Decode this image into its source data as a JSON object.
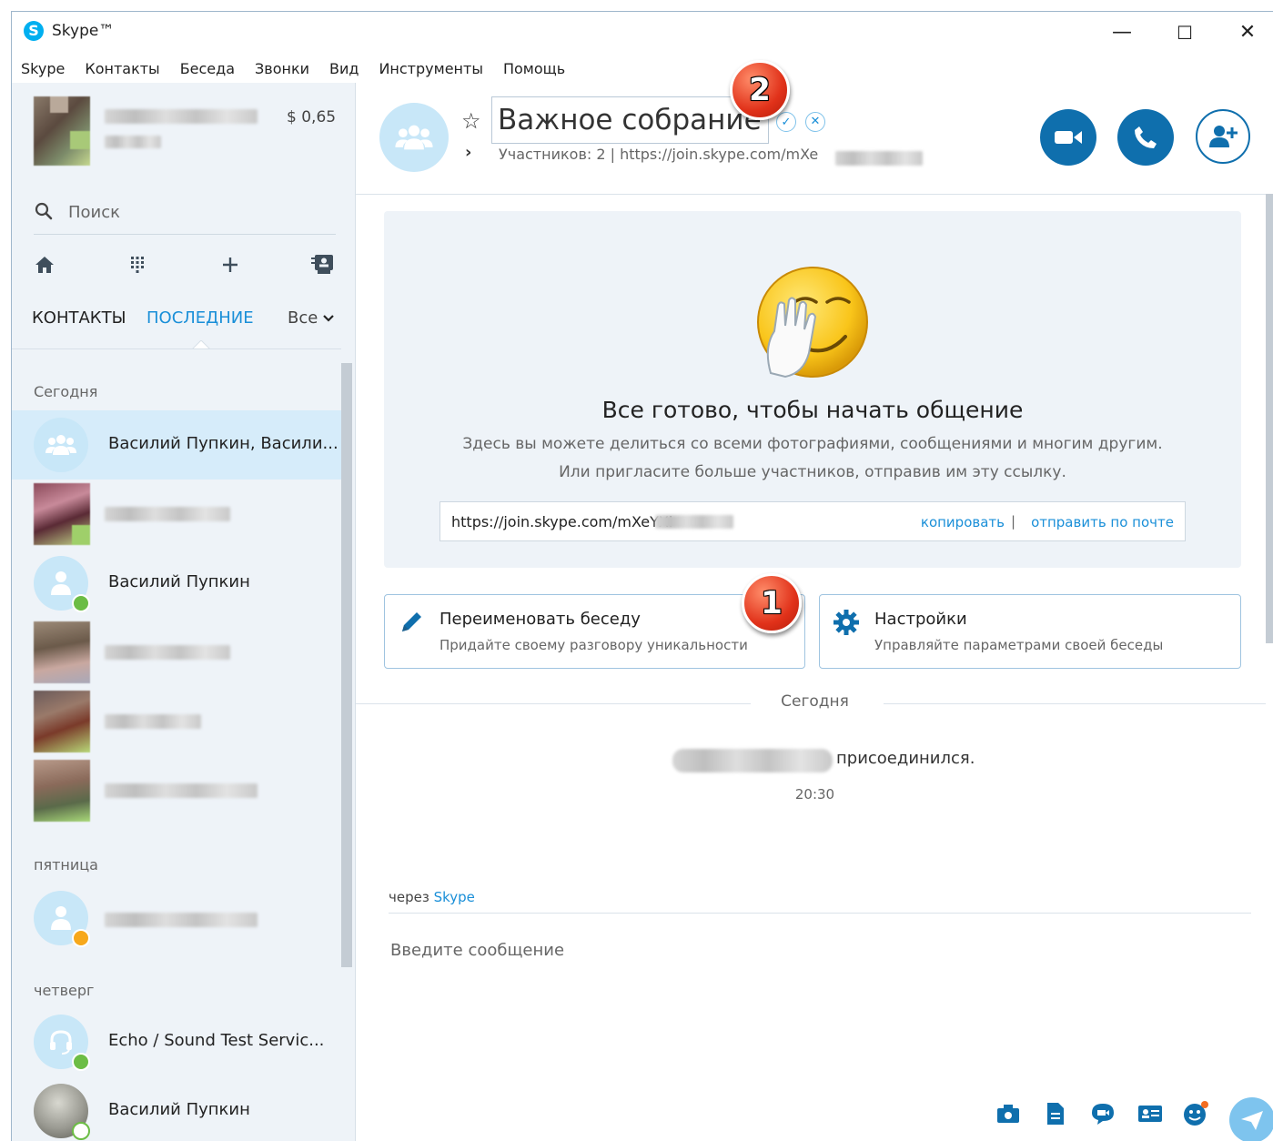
{
  "titlebar": {
    "app_name": "Skype™",
    "minimize": "—",
    "maximize": "☐",
    "close": "✕"
  },
  "menu": [
    "Skype",
    "Контакты",
    "Беседа",
    "Звонки",
    "Вид",
    "Инструменты",
    "Помощь"
  ],
  "profile": {
    "balance": "$ 0,65"
  },
  "search": {
    "placeholder": "Поиск"
  },
  "nav_icons": [
    "home-icon",
    "dialpad-icon",
    "plus-icon",
    "contacts-card-icon"
  ],
  "tabs": {
    "contacts": "КОНТАКТЫ",
    "recent": "ПОСЛЕДНИЕ",
    "filter": "Все"
  },
  "list": {
    "sections": {
      "today": "Сегодня",
      "friday": "пятница",
      "thursday": "четверг"
    },
    "items": [
      {
        "name": "Василий Пупкин, Васили...",
        "type": "group",
        "selected": true
      },
      {
        "name": "",
        "type": "blurred"
      },
      {
        "name": "Василий Пупкин",
        "type": "person",
        "status": "online"
      },
      {
        "name": "",
        "type": "blurred"
      },
      {
        "name": "",
        "type": "blurred"
      },
      {
        "name": "",
        "type": "blurred"
      },
      {
        "name": "",
        "type": "person",
        "status": "away"
      },
      {
        "name": "Echo / Sound Test Servic...",
        "type": "echo",
        "status": "online"
      },
      {
        "name": "Василий Пупкин",
        "type": "photo",
        "status": "online"
      }
    ]
  },
  "conversation": {
    "title": "Важное собрание",
    "subtitle": "Участников: 2 | https://join.skype.com/mXe",
    "welcome_title": "Все готово, чтобы начать общение",
    "welcome_line1": "Здесь вы можете делиться со всеми фотографиями, сообщениями и многим другим.",
    "welcome_line2": "Или пригласите больше участников, отправив им эту ссылку.",
    "link": "https://join.skype.com/mXeYXi",
    "copy": "копировать",
    "link_sep": "|",
    "send_mail": "отправить по почте",
    "rename_title": "Переименовать беседу",
    "rename_sub": "Придайте своему разговору уникальности",
    "settings_title": "Настройки",
    "settings_sub": "Управляйте параметрами своей беседы",
    "date_divider": "Сегодня",
    "joined": "присоединился.",
    "time": "20:30",
    "via": "через",
    "via_link": "Skype",
    "message_placeholder": "Введите сообщение"
  },
  "badges": {
    "one": "1",
    "two": "2"
  },
  "colors": {
    "accent": "#1a8fd8",
    "call_button": "#0f6fad",
    "selected_row": "#d6ecfa",
    "sidebar_bg": "#eef3f8",
    "online": "#6cbd45",
    "away": "#f7a81b",
    "badge": "#e1321a"
  }
}
